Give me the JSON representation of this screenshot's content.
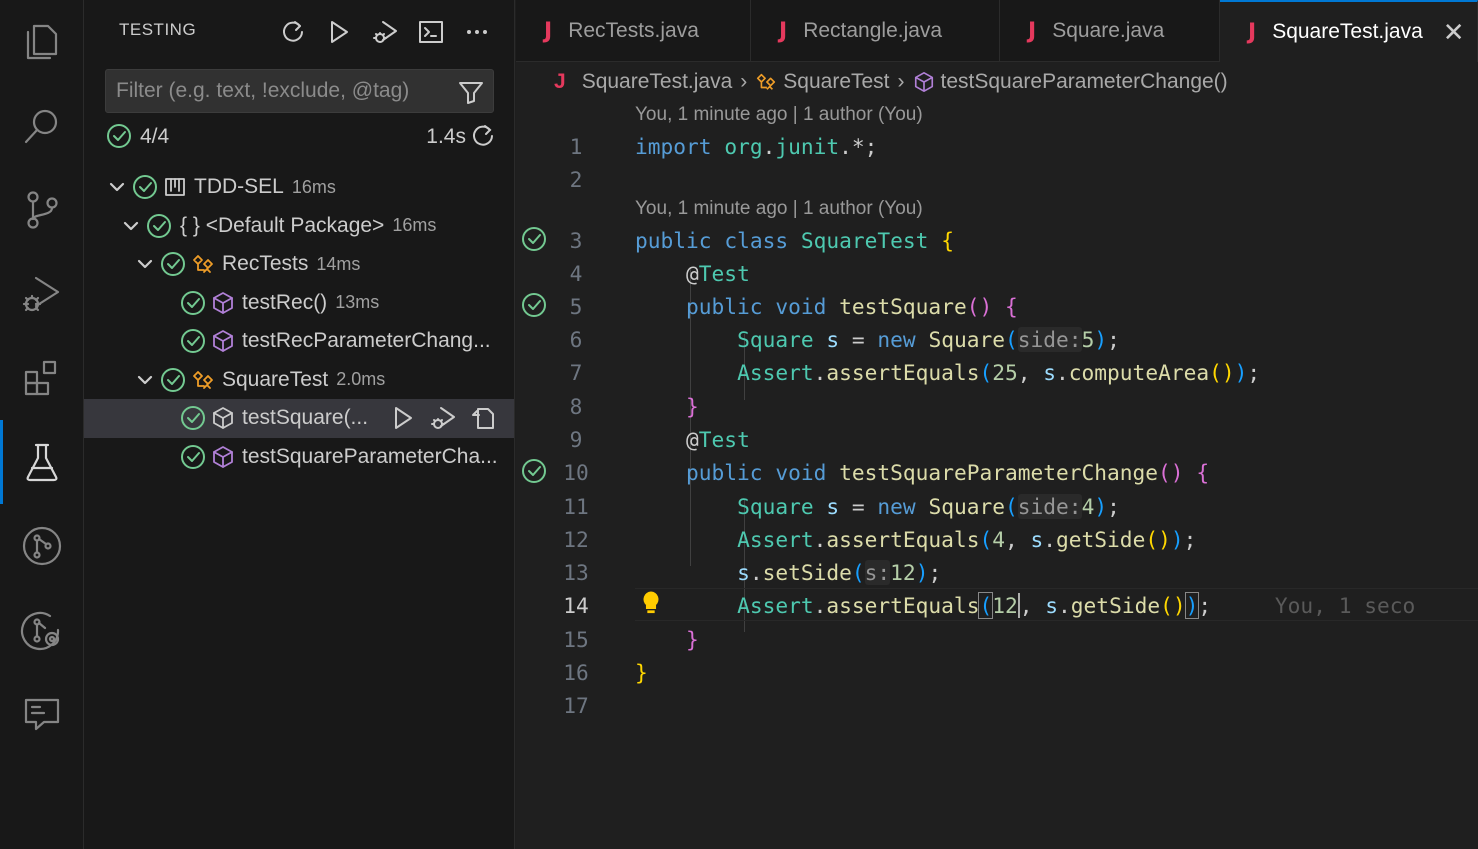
{
  "activity_bar": {
    "items": [
      {
        "name": "explorer-icon"
      },
      {
        "name": "search-icon"
      },
      {
        "name": "source-control-icon"
      },
      {
        "name": "run-debug-icon"
      },
      {
        "name": "extensions-icon"
      },
      {
        "name": "testing-icon",
        "active": true
      },
      {
        "name": "git-graph-icon"
      },
      {
        "name": "remote-icon"
      },
      {
        "name": "comments-icon"
      }
    ]
  },
  "sidebar": {
    "title": "TESTING",
    "filter_placeholder": "Filter (e.g. text, !exclude, @tag)",
    "summary": {
      "count": "4/4",
      "duration": "1.4s"
    },
    "tree": [
      {
        "label": "TDD-SEL",
        "duration": "16ms"
      },
      {
        "label": "{ } <Default Package>",
        "duration": "16ms"
      },
      {
        "label": "RecTests",
        "duration": "14ms"
      },
      {
        "label": "testRec()",
        "duration": "13ms"
      },
      {
        "label": "testRecParameterChang...",
        "duration": ""
      },
      {
        "label": "SquareTest",
        "duration": "2.0ms"
      },
      {
        "label": "testSquare(...",
        "duration": ""
      },
      {
        "label": "testSquareParameterCha...",
        "duration": ""
      }
    ]
  },
  "tabs": [
    {
      "label": "RecTests.java",
      "icon": "J"
    },
    {
      "label": "Rectangle.java",
      "icon": "J"
    },
    {
      "label": "Square.java",
      "icon": "J"
    },
    {
      "label": "SquareTest.java",
      "icon": "J",
      "active": true
    }
  ],
  "breadcrumb": {
    "file": "SquareTest.java",
    "class": "SquareTest",
    "method": "testSquareParameterChange()"
  },
  "editor": {
    "codelens": "You, 1 minute ago | 1 author (You)",
    "inline_blame": "You, 1 seco",
    "line_numbers": [
      "1",
      "2",
      "3",
      "4",
      "5",
      "6",
      "7",
      "8",
      "9",
      "10",
      "11",
      "12",
      "13",
      "14",
      "15",
      "16",
      "17"
    ],
    "current_line": "14",
    "tokens": {
      "import": "import",
      "org": "org",
      "junit": "junit",
      "star": ".*;",
      "public": "public",
      "class": "class",
      "void": "void",
      "new": "new",
      "SquareTest": "SquareTest",
      "Test": "Test",
      "at": "@",
      "testSquare": "testSquare",
      "testSquareParameterChange": "testSquareParameterChange",
      "Square": "Square",
      "s": "s",
      "Assert": "Assert",
      "assertEquals": "assertEquals",
      "computeArea": "computeArea",
      "getSide": "getSide",
      "setSide": "setSide",
      "hint_side": "side:",
      "hint_s": "s:",
      "n5": "5",
      "n4": "4",
      "n25": "25",
      "n12": "12"
    }
  },
  "colors": {
    "accent": "#0078d4",
    "pass": "#73c991",
    "java_icon": "#e5395d"
  }
}
